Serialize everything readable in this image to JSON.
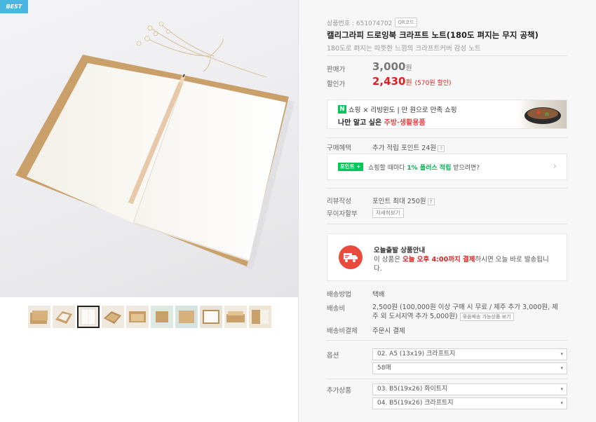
{
  "badge": "BEST",
  "gallery": {
    "thumbnail_count": 10,
    "selected_index": 2
  },
  "product": {
    "code_label": "상품번호 : 651074702",
    "qr_label": "QR코드",
    "title": "캘리그라피 드로잉북 크라프트 노트(180도 펴지는 무지 공책)",
    "subtitle": "180도로 펴지는 따뜻한 느낌의 크라프트커버 감성 노트"
  },
  "pricing": {
    "price_label": "판매가",
    "price_value": "3,000",
    "price_unit": "원",
    "sale_label": "할인가",
    "sale_value": "2,430",
    "sale_unit": "원",
    "discount_text": "(570원 할인)"
  },
  "banner": {
    "npay_letter": "N",
    "line1": "쇼핑 × 리빙윈도 | 만 원으로 만족 쇼핑",
    "line2_prefix": "나만 알고 싶은 ",
    "line2_highlight": "주방·생활용품"
  },
  "benefit": {
    "label": "구매혜택",
    "value": "추가 적립 포인트 24원",
    "qmark": "?"
  },
  "point_box": {
    "badge": "포인트 +",
    "text_prefix": "쇼핑할 때마다 ",
    "text_bold": "1% 플러스 적립",
    "text_suffix": " 받으려면?",
    "chevron": "›"
  },
  "review": {
    "label": "리뷰작성",
    "value": "포인트 최대 250원",
    "qmark": "?"
  },
  "installment": {
    "label": "무이자할부",
    "button": "자세히보기"
  },
  "delivery_notice": {
    "title": "오늘출발 상품안내",
    "text_prefix": "이 상품은 ",
    "text_red": "오늘 오후 4:00까지 결제",
    "text_suffix": "하시면 오늘 바로 발송됩니다."
  },
  "shipping": {
    "method_label": "배송방법",
    "method_value": "택배",
    "fee_label": "배송비",
    "fee_value": "2,500원 (100,000원 이상 구매 시 무료 / 제주 추가 3,000원, 제주 외 도서지역 추가 5,000원)",
    "fee_button": "묶음배송 가능상품 보기",
    "pay_label": "배송비결제",
    "pay_value": "주문시 결제"
  },
  "options": {
    "label": "옵션",
    "selects": [
      "02. A5 (13x19) 크라프트지",
      "58매"
    ]
  },
  "addons": {
    "label": "추가상품",
    "selects": [
      "03. B5(19x26) 화이트지",
      "04. B5(19x26) 크라프트지"
    ]
  },
  "icons": {
    "dropdown_arrow": "▾",
    "truck": "truck-icon"
  },
  "colors": {
    "accent_red": "#e02020",
    "npay_green": "#03c75a",
    "best_blue": "#4ab7e0"
  }
}
